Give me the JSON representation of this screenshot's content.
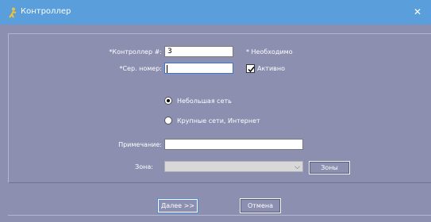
{
  "window": {
    "title": "Контроллер",
    "close_symbol": "✕",
    "icon": "controller-figure-icon"
  },
  "form": {
    "controller_label": "*Контроллер #:",
    "controller_value": "3",
    "required_note": "* Необходимо",
    "serial_label": "*Сер. номер:",
    "serial_value": "",
    "active_label": "Активно",
    "active_checked": true,
    "radio_small_label": "Небольшая сеть",
    "radio_small_selected": true,
    "radio_large_label": "Крупные сети, Интернет",
    "note_label": "Примечание:",
    "note_value": "",
    "zone_label": "Зона:",
    "zone_value": "",
    "zones_button": "Зоны"
  },
  "buttons": {
    "next": "Далее >>",
    "cancel": "Отмена"
  },
  "colors": {
    "background": "#8c8fb0",
    "titlebar": "#5a9fdb"
  }
}
